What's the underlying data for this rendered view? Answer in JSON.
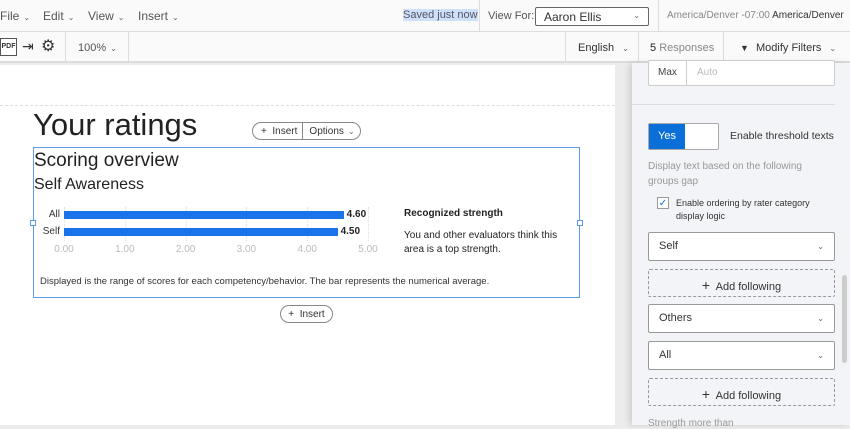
{
  "menu": {
    "file": "File",
    "edit": "Edit",
    "view": "View",
    "insert": "Insert"
  },
  "status": {
    "saved": "Saved just now",
    "view_for_label": "View For:",
    "view_for_value": "Aaron Ellis",
    "timezone_muted": "America/Denver -07:00",
    "timezone": "America/Denver"
  },
  "toolbar": {
    "zoom": "100%",
    "language": "English",
    "responses_count": "5",
    "responses_label": "Responses",
    "filters": "Modify Filters",
    "pdf": "PDF"
  },
  "page": {
    "title": "Your ratings",
    "insert": "Insert",
    "options": "Options",
    "insert_below": "Insert"
  },
  "widget": {
    "title": "Scoring overview",
    "subtitle": "Self Awareness",
    "threshold_title": "Recognized strength",
    "threshold_text": "You and other evaluators think this area is a top strength.",
    "footnote": "Displayed is the range of scores for each competency/behavior. The bar represents the numerical average."
  },
  "chart_data": {
    "type": "bar",
    "orientation": "horizontal",
    "categories": [
      "All",
      "Self"
    ],
    "values": [
      4.6,
      4.5
    ],
    "value_labels": [
      "4.60",
      "4.50"
    ],
    "xlim": [
      0,
      5
    ],
    "xticks": [
      "0.00",
      "1.00",
      "2.00",
      "3.00",
      "4.00",
      "5.00"
    ],
    "color": "#1a73e8"
  },
  "panel": {
    "max_label": "Max",
    "max_placeholder": "Auto",
    "toggle_yes": "Yes",
    "toggle_label": "Enable threshold texts",
    "description": "Display text based on the following groups gap",
    "checkbox_label": "Enable ordering by rater category display logic",
    "select1": "Self",
    "add1": "Add following",
    "select2": "Others",
    "select3": "All",
    "add2": "Add following",
    "next_label": "Strength more than"
  },
  "colors": {
    "accent": "#0b6fd9",
    "bar": "#1a73e8",
    "selection": "#5b9bf0"
  }
}
